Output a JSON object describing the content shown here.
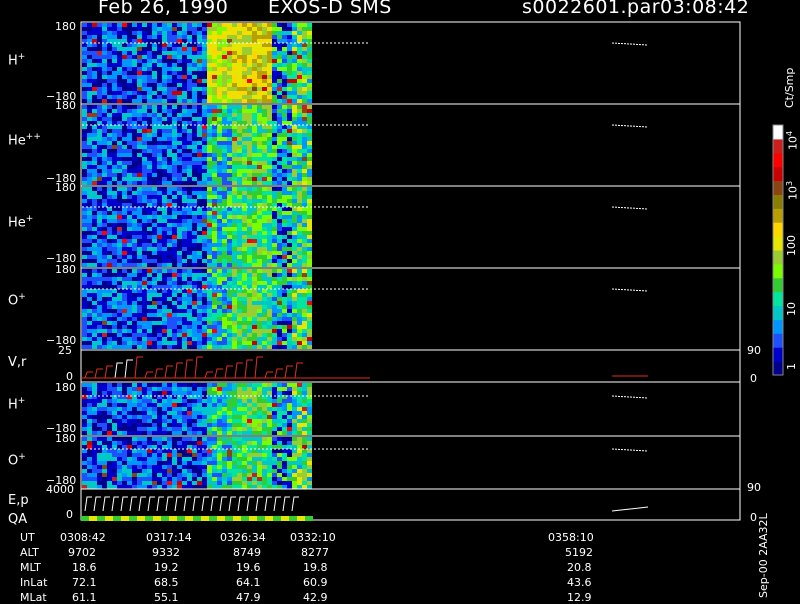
{
  "header": {
    "date": "Feb 26, 1990",
    "instrument": "EXOS-D SMS",
    "file": "s0022601.par",
    "time": "03:08:42"
  },
  "panels": [
    {
      "label": "H",
      "sup": "+",
      "top_tick": "180",
      "bottom_tick": "−180"
    },
    {
      "label": "He",
      "sup": "++",
      "top_tick": "180",
      "bottom_tick": "−180"
    },
    {
      "label": "He",
      "sup": "+",
      "top_tick": "180",
      "bottom_tick": "−180"
    },
    {
      "label": "O",
      "sup": "+",
      "top_tick": "180",
      "bottom_tick": "−180"
    },
    {
      "label": "V,r",
      "sup": "",
      "top_tick": "25",
      "bottom_tick": "0",
      "right_top": "90",
      "right_bottom": "0"
    },
    {
      "label": "H",
      "sup": "+",
      "top_tick": "180",
      "bottom_tick": "−180"
    },
    {
      "label": "O",
      "sup": "+",
      "top_tick": "180",
      "bottom_tick": "−180"
    },
    {
      "label": "E,p",
      "sup": "",
      "top_tick": "4000",
      "bottom_tick": "0",
      "right_top": "90",
      "right_bottom": "0"
    }
  ],
  "qa_label": "QA",
  "colorbar": {
    "units": "Ct/Smp",
    "tick_labels": [
      "1",
      "10",
      "100",
      "10",
      "10"
    ],
    "tick_exps": [
      "",
      "",
      "",
      "3",
      "4"
    ],
    "colors": [
      "#00008b",
      "#0000cd",
      "#1e50ff",
      "#0096ff",
      "#00c8c8",
      "#00e6a0",
      "#32cd32",
      "#7cfc00",
      "#9acd32",
      "#e6e600",
      "#ffd700",
      "#b8a000",
      "#8b7d00",
      "#8b4513",
      "#cc0000",
      "#ff0000",
      "#cc2020",
      "#ffffff"
    ]
  },
  "footer": {
    "rows": [
      {
        "name": "UT",
        "values": [
          "0308:42",
          "0317:14",
          "0326:34",
          "0332:10",
          "0358:10"
        ]
      },
      {
        "name": "ALT",
        "values": [
          "9702",
          "9332",
          "8749",
          "8277",
          "5192"
        ]
      },
      {
        "name": "MLT",
        "values": [
          "18.6",
          "19.2",
          "19.6",
          "19.8",
          "20.8"
        ]
      },
      {
        "name": "InLat",
        "values": [
          "72.1",
          "68.5",
          "64.1",
          "60.9",
          "43.6"
        ]
      },
      {
        "name": "MLat",
        "values": [
          "61.1",
          "55.1",
          "47.9",
          "42.9",
          "12.9"
        ]
      }
    ],
    "version": "Sep-00  2AA32L"
  },
  "chart_data": {
    "type": "heatmap",
    "title": "Feb 26, 1990   EXOS-D SMS",
    "x_ticks": [
      "0308:42",
      "0317:14",
      "0326:34",
      "0332:10",
      "0358:10"
    ],
    "panels": [
      "H+",
      "He++",
      "He+",
      "O+",
      "V,r",
      "H+",
      "O+",
      "E,p"
    ],
    "ylim_pitch": [
      -180,
      180
    ],
    "color_scale": "log",
    "color_units": "Ct/Smp",
    "color_range": [
      1,
      10000
    ]
  }
}
